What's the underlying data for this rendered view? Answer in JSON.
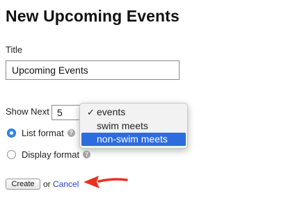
{
  "page": {
    "title": "New Upcoming Events"
  },
  "form": {
    "title_label": "Title",
    "title_value": "Upcoming Events",
    "show_next_label": "Show Next",
    "show_next_value": "5",
    "dropdown": {
      "options": [
        "events",
        "swim meets",
        "non-swim meets"
      ],
      "checked_option": "events",
      "highlighted_option": "non-swim meets"
    },
    "format_options": [
      {
        "label": "List format",
        "selected": true
      },
      {
        "label": "Display format",
        "selected": false
      }
    ],
    "help_glyph": "?",
    "create_label": "Create",
    "or_text": "or",
    "cancel_label": "Cancel"
  },
  "annotation": {
    "arrow_color": "#e8321e"
  },
  "icons": {
    "check": "checkmark-icon",
    "help": "help-icon",
    "arrow": "red-arrow-icon"
  }
}
